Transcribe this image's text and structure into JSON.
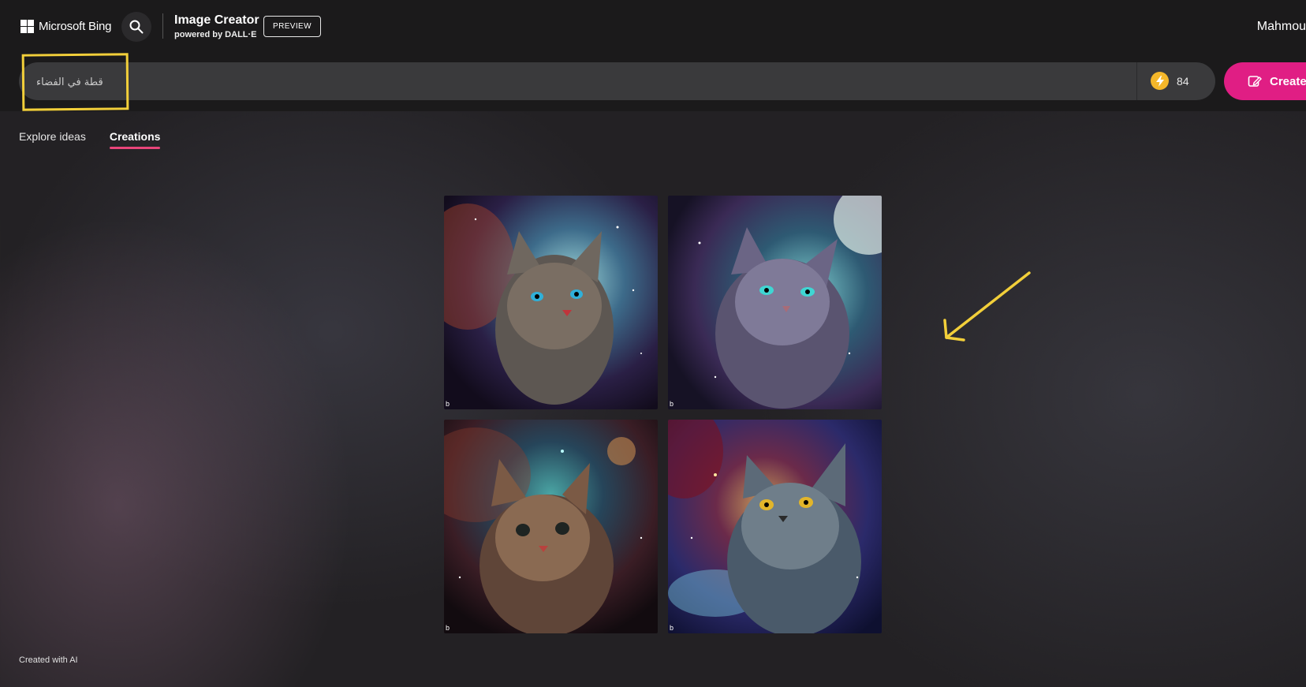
{
  "header": {
    "brand": "Microsoft Bing",
    "title": "Image Creator",
    "subtitle": "powered by DALL·E",
    "badge": "PREVIEW",
    "user": "Mahmou"
  },
  "prompt": {
    "value": "قطة في الفضاء",
    "boosts": "84",
    "create_label": "Create"
  },
  "tabs": [
    {
      "label": "Explore ideas",
      "active": false
    },
    {
      "label": "Creations",
      "active": true
    }
  ],
  "results": [
    {
      "alt": "cat in space 1",
      "watermark": "b"
    },
    {
      "alt": "cat in space 2",
      "watermark": "b"
    },
    {
      "alt": "cat in space 3",
      "watermark": "b"
    },
    {
      "alt": "cat in space 4",
      "watermark": "b"
    }
  ],
  "footer": {
    "note": "Created with AI"
  },
  "colors": {
    "accent": "#e01e84",
    "annotation": "#f2cf3a",
    "coin": "#f4b72a"
  }
}
